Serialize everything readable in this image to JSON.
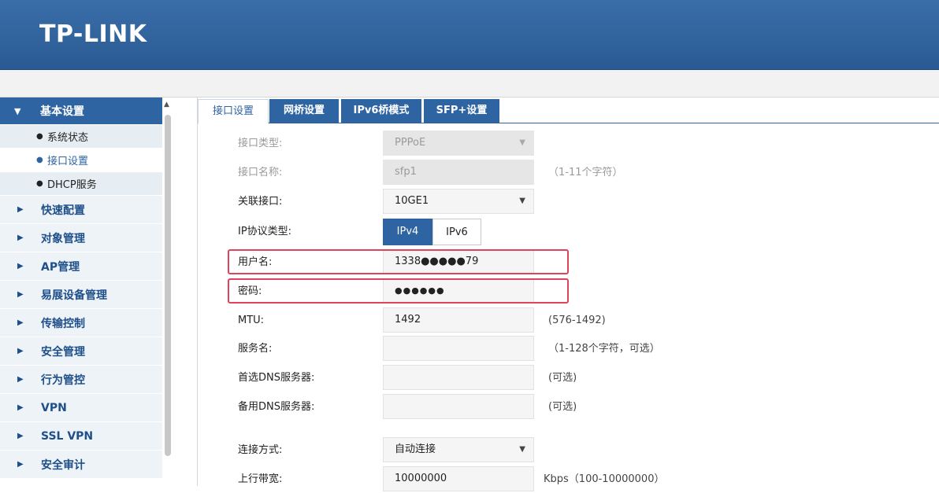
{
  "brand": {
    "logo": "TP-LINK"
  },
  "sidebar": {
    "group": {
      "label": "基本设置"
    },
    "subitems": [
      {
        "label": "系统状态"
      },
      {
        "label": "接口设置"
      },
      {
        "label": "DHCP服务"
      }
    ],
    "items": [
      {
        "label": "快速配置"
      },
      {
        "label": "对象管理"
      },
      {
        "label": "AP管理"
      },
      {
        "label": "易展设备管理"
      },
      {
        "label": "传输控制"
      },
      {
        "label": "安全管理"
      },
      {
        "label": "行为管控"
      },
      {
        "label": "VPN"
      },
      {
        "label": "SSL VPN"
      },
      {
        "label": "安全审计"
      }
    ]
  },
  "tabs": [
    {
      "label": "接口设置"
    },
    {
      "label": "网桥设置"
    },
    {
      "label": "IPv6桥模式"
    },
    {
      "label": "SFP+设置"
    }
  ],
  "form": {
    "iface_type": {
      "label": "接口类型:",
      "value": "PPPoE"
    },
    "iface_name": {
      "label": "接口名称:",
      "value": "sfp1",
      "hint": "（1-11个字符）"
    },
    "linked_iface": {
      "label": "关联接口:",
      "value": "10GE1"
    },
    "ip_proto": {
      "label": "IP协议类型:",
      "ipv4": "IPv4",
      "ipv6": "IPv6"
    },
    "username": {
      "label": "用户名:",
      "value": "1338●●●●●79"
    },
    "password": {
      "label": "密码:",
      "value": "●●●●●●"
    },
    "mtu": {
      "label": "MTU:",
      "value": "1492",
      "hint": "(576-1492)"
    },
    "service": {
      "label": "服务名:",
      "value": "",
      "hint": "（1-128个字符，可选）"
    },
    "dns1": {
      "label": "首选DNS服务器:",
      "value": "",
      "hint": "(可选)"
    },
    "dns2": {
      "label": "备用DNS服务器:",
      "value": "",
      "hint": "(可选)"
    },
    "connect_mode": {
      "label": "连接方式:",
      "value": "自动连接"
    },
    "uplink": {
      "label": "上行带宽:",
      "value": "10000000",
      "hint": "Kbps（100-10000000）"
    }
  },
  "colors": {
    "primary": "#2f64a3",
    "highlight": "#e0435a"
  }
}
